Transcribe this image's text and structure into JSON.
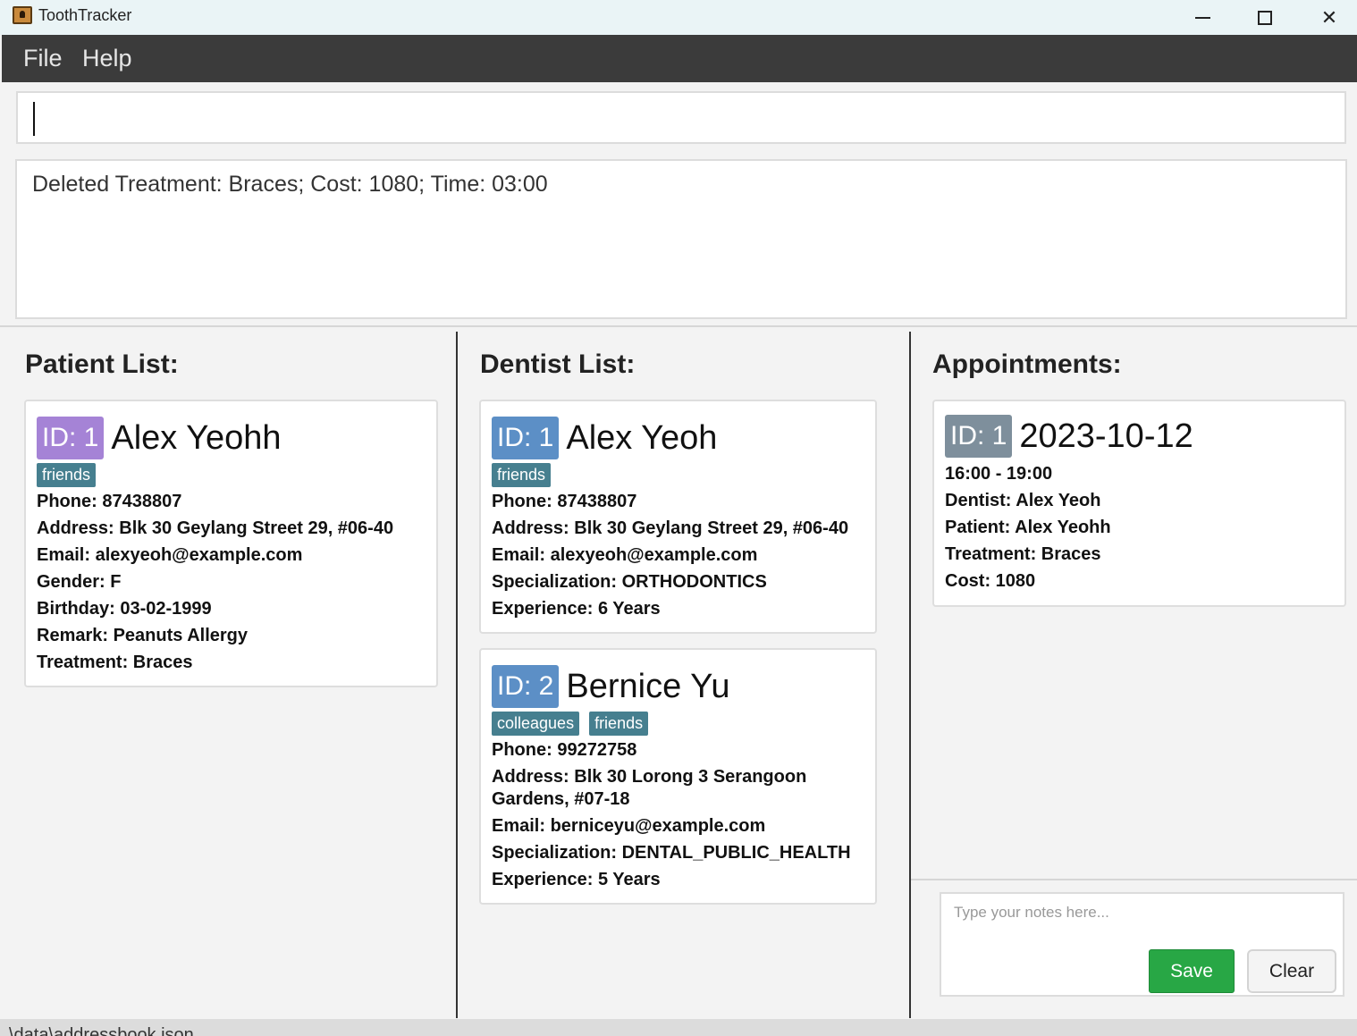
{
  "window": {
    "title": "ToothTracker"
  },
  "menu": {
    "file": "File",
    "help": "Help"
  },
  "command": {
    "value": ""
  },
  "result": {
    "text": "Deleted Treatment: Braces; Cost: 1080; Time: 03:00"
  },
  "headings": {
    "patients": "Patient List:",
    "dentists": "Dentist List:",
    "appointments": "Appointments:"
  },
  "patients": [
    {
      "id": "ID: 1",
      "name": "Alex Yeohh",
      "tags": [
        "friends"
      ],
      "phone": "Phone: 87438807",
      "address": "Address: Blk 30 Geylang Street 29, #06-40",
      "email": "Email: alexyeoh@example.com",
      "gender": "Gender: F",
      "birthday": "Birthday: 03-02-1999",
      "remark": "Remark: Peanuts Allergy",
      "treatment": "Treatment: Braces"
    }
  ],
  "dentists": [
    {
      "id": "ID: 1",
      "name": "Alex Yeoh",
      "tags": [
        "friends"
      ],
      "phone": "Phone: 87438807",
      "address": "Address: Blk 30 Geylang Street 29, #06-40",
      "email": "Email: alexyeoh@example.com",
      "specialization": "Specialization: ORTHODONTICS",
      "experience": "Experience: 6 Years"
    },
    {
      "id": "ID: 2",
      "name": "Bernice Yu",
      "tags": [
        "colleagues",
        "friends"
      ],
      "phone": "Phone: 99272758",
      "address_line1": "Address: Blk 30 Lorong 3 Serangoon",
      "address_line2": "Gardens, #07-18",
      "email": "Email: berniceyu@example.com",
      "specialization": "Specialization: DENTAL_PUBLIC_HEALTH",
      "experience": "Experience: 5 Years"
    }
  ],
  "appointments": [
    {
      "id": "ID: 1",
      "date": "2023-10-12",
      "time": "16:00 - 19:00",
      "dentist": "Dentist: Alex Yeoh",
      "patient": "Patient: Alex Yeohh",
      "treatment": "Treatment: Braces",
      "cost": "Cost: 1080"
    }
  ],
  "notes": {
    "placeholder": "Type your notes here...",
    "save_label": "Save",
    "clear_label": "Clear"
  },
  "status": {
    "text": "\\data\\addressbook.json"
  },
  "icons": {
    "app": "tooth-tracker-app-icon",
    "minimize": "minimize-icon",
    "maximize": "maximize-icon",
    "close": "close-icon"
  },
  "colors": {
    "menubar": "#3b3b3b",
    "patient_id_badge": "#a583d6",
    "dentist_id_badge": "#5c8fc6",
    "appointment_id_badge": "#7e8f9c",
    "tag": "#467f8f",
    "save_button": "#28a745"
  }
}
